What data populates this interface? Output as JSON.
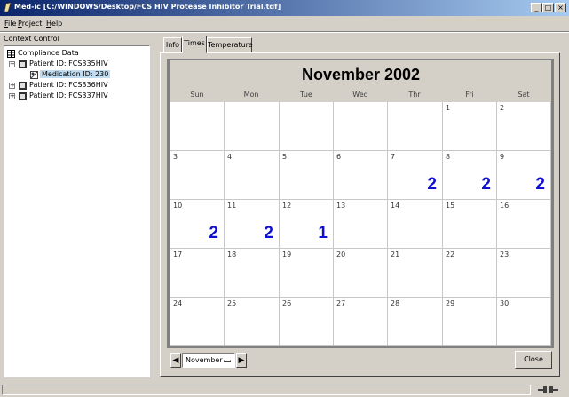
{
  "window": {
    "title": "Med-ic [C:/WINDOWS/Desktop/FCS HIV Protease Inhibitor Trial.tdf]",
    "minimize": "_",
    "maximize": "□",
    "close": "×"
  },
  "menu": {
    "items": [
      {
        "first": "F",
        "rest": "ile"
      },
      {
        "first": "P",
        "rest": "roject"
      },
      {
        "first": "H",
        "rest": "elp"
      }
    ]
  },
  "left_panel": {
    "header": "Context Control",
    "tree": [
      {
        "label": "Compliance Data",
        "expander": ""
      },
      {
        "label": "Patient ID: FCS335HIV",
        "expander": "−"
      },
      {
        "label": "Medication ID: 230",
        "expander": ""
      },
      {
        "label": "Patient ID: FCS336HIV",
        "expander": "+"
      },
      {
        "label": "Patient ID: FCS337HIV",
        "expander": "+"
      }
    ]
  },
  "tabs": [
    {
      "label": "Info"
    },
    {
      "label": "Times"
    },
    {
      "label": "Temperature"
    }
  ],
  "calendar": {
    "title": "November 2002",
    "weekdays": [
      "Sun",
      "Mon",
      "Tue",
      "Wed",
      "Thr",
      "Fri",
      "Sat"
    ],
    "weeks": [
      [
        {
          "d": ""
        },
        {
          "d": ""
        },
        {
          "d": ""
        },
        {
          "d": ""
        },
        {
          "d": ""
        },
        {
          "d": "1"
        },
        {
          "d": "2"
        }
      ],
      [
        {
          "d": "3"
        },
        {
          "d": "4"
        },
        {
          "d": "5"
        },
        {
          "d": "6"
        },
        {
          "d": "7",
          "c": "2"
        },
        {
          "d": "8",
          "c": "2"
        },
        {
          "d": "9",
          "c": "2"
        }
      ],
      [
        {
          "d": "10",
          "c": "2"
        },
        {
          "d": "11",
          "c": "2"
        },
        {
          "d": "12",
          "c": "1"
        },
        {
          "d": "13"
        },
        {
          "d": "14"
        },
        {
          "d": "15"
        },
        {
          "d": "16"
        }
      ],
      [
        {
          "d": "17"
        },
        {
          "d": "18"
        },
        {
          "d": "19"
        },
        {
          "d": "20"
        },
        {
          "d": "21"
        },
        {
          "d": "22"
        },
        {
          "d": "23"
        }
      ],
      [
        {
          "d": "24"
        },
        {
          "d": "25"
        },
        {
          "d": "26"
        },
        {
          "d": "27"
        },
        {
          "d": "28"
        },
        {
          "d": "29"
        },
        {
          "d": "30"
        }
      ]
    ],
    "count_color": "#1010d0"
  },
  "controls": {
    "prev_arrow": "◀",
    "next_arrow": "▶",
    "month_value": "November",
    "close_label": "Close"
  },
  "status": {
    "text": "",
    "icon": "connection-icon"
  }
}
